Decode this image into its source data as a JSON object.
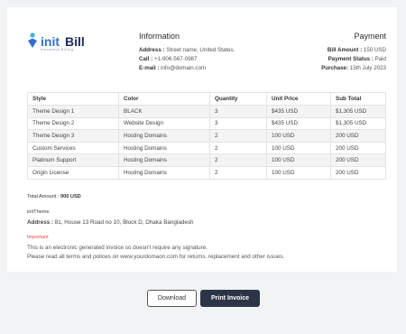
{
  "logo": {
    "brand": "initBill",
    "tagline": "Innovative Billing"
  },
  "info": {
    "heading": "Information",
    "address_label": "Address :",
    "address_value": "Street name, United States.",
    "call_label": "Call :",
    "call_value": "+1-906-567-0987",
    "email_label": "E-mail :",
    "email_value": "info@domain.com"
  },
  "payment": {
    "heading": "Payment",
    "bill_label": "Bill Amount :",
    "bill_value": "150 USD",
    "status_label": "Payment Status :",
    "status_value": "Paid",
    "purchase_label": "Purchase:",
    "purchase_value": "15th July 2023"
  },
  "table": {
    "headers": [
      "Style",
      "Color",
      "Quantity",
      "Unit Price",
      "Sub Total"
    ],
    "rows": [
      [
        "Theme Design 1",
        "BLACK",
        "3",
        "$435 USD",
        "$1,305 USD"
      ],
      [
        "Theme Design 2",
        "Website Design",
        "3",
        "$435 USD",
        "$1,305 USD"
      ],
      [
        "Theme Design 3",
        "Hosting Domains",
        "2",
        "100 USD",
        "200 USD"
      ],
      [
        "Custom Services",
        "Hosting Domains",
        "2",
        "100 USD",
        "200 USD"
      ],
      [
        "Platinum Support",
        "Hosting Domains",
        "2",
        "100 USD",
        "200 USD"
      ],
      [
        "Origin License",
        "Hosting Domains",
        "2",
        "100 USD",
        "200 USD"
      ]
    ]
  },
  "summary": {
    "total_label": "Total Amount :",
    "total_value": "900 USD",
    "company": "initTheme",
    "address_label": "Address :",
    "address_value": "81, House 13 Road no 10, Block D, Dhaka Bangladesh",
    "important": "Important",
    "note1": "This is an electronic generated invoice so doesn't require any signature.",
    "note2": "Please read all terms and polices on www.yourdomaon.com for returns, replacement and other issues."
  },
  "actions": {
    "download": "Download",
    "print": "Print Invoice"
  },
  "colors": {
    "accent": "#2f6fd6",
    "accent_light": "#35b6e8",
    "dark_button": "#2c3547",
    "important": "#e04848"
  }
}
